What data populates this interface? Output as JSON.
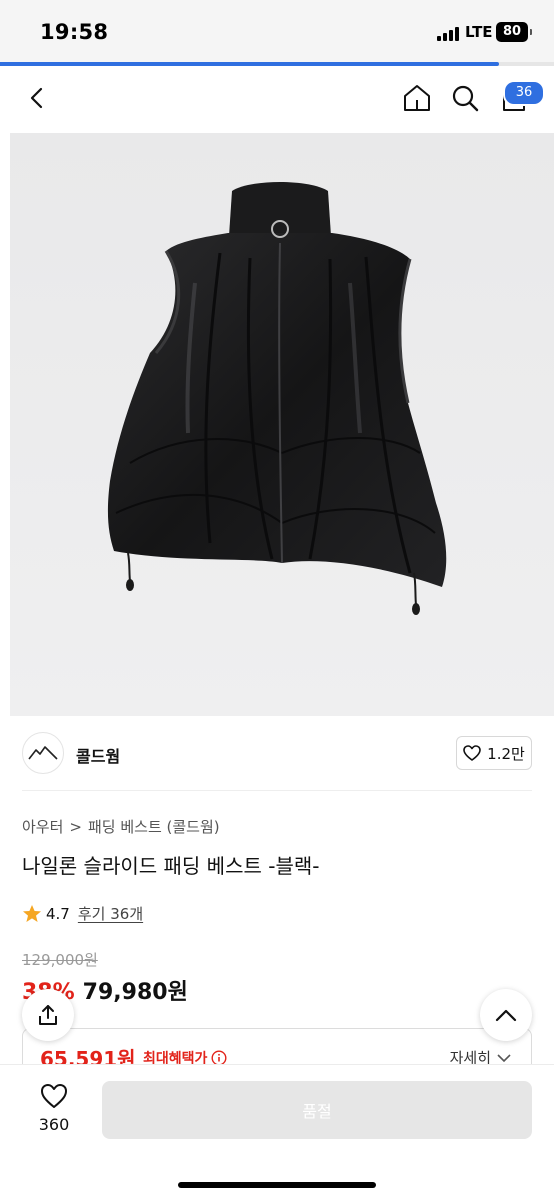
{
  "status_bar": {
    "time": "19:58",
    "network": "LTE",
    "battery": "80"
  },
  "scroll_progress": 0.9,
  "nav": {
    "back_icon": "chevron-left-icon",
    "home_icon": "home-icon",
    "search_icon": "search-icon",
    "cart_icon": "cart-icon",
    "cart_count": "36"
  },
  "brand": {
    "name": "콜드웜",
    "like_count": "1.2만"
  },
  "breadcrumb": {
    "category": "아우터",
    "separator": ">",
    "subcategory": "패딩 베스트 (콜드웜)"
  },
  "product": {
    "title": "나일론 슬라이드 패딩 베스트 -블랙-",
    "rating": "4.7",
    "reviews": "후기 36개",
    "original_price": "129,000원",
    "discount": "38%",
    "sale_price": "79,980원"
  },
  "benefit": {
    "price": "65,591원",
    "label": "최대혜택가",
    "more": "자세히"
  },
  "bottom": {
    "wish_count": "360",
    "buy_label": "품절"
  },
  "colors": {
    "accent": "#2f6fe0",
    "sale_red": "#e2231a",
    "disabled_button": "#e6e6e6"
  }
}
